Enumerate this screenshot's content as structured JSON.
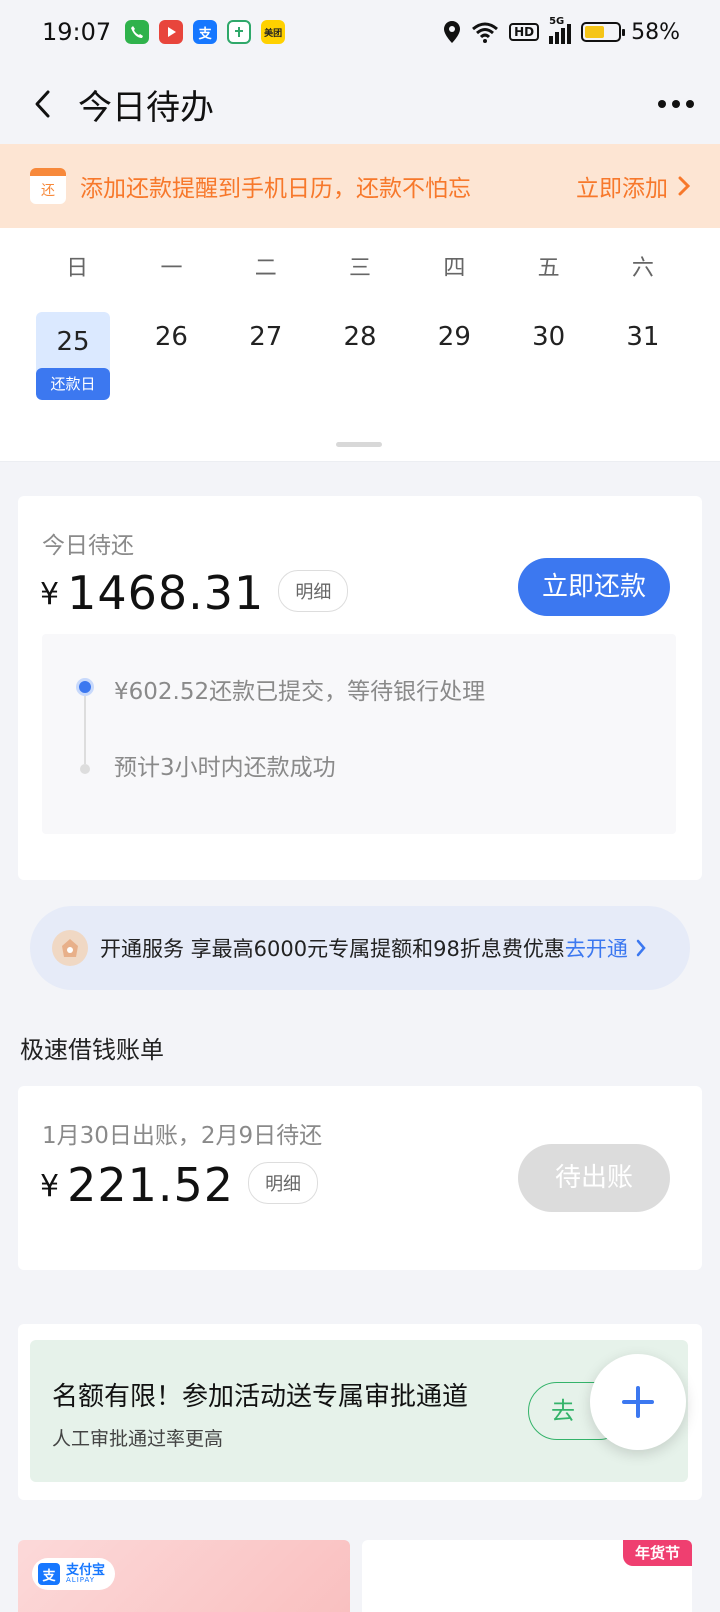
{
  "status_bar": {
    "time": "19:07",
    "battery": "58%",
    "battery_level": 0.58,
    "hd": "HD",
    "network": "5G",
    "app_icons": [
      "phone-icon",
      "video-icon",
      "alipay-icon",
      "health-icon",
      "meituan-icon"
    ],
    "meituan_label": "美团"
  },
  "nav": {
    "title": "今日待办"
  },
  "reminder": {
    "icon_label": "还",
    "text": "添加还款提醒到手机日历，还款不怕忘",
    "action": "立即添加"
  },
  "calendar": {
    "weekdays": [
      "日",
      "一",
      "二",
      "三",
      "四",
      "五",
      "六"
    ],
    "dates": [
      "25",
      "26",
      "27",
      "28",
      "29",
      "30",
      "31"
    ],
    "selected_date": "25",
    "selected_tag": "还款日"
  },
  "today": {
    "label": "今日待还",
    "currency": "¥",
    "amount": "1468.31",
    "detail": "明细",
    "pay_button": "立即还款",
    "steps": [
      "¥602.52还款已提交，等待银行处理",
      "预计3小时内还款成功"
    ]
  },
  "promo": {
    "text": "开通服务 享最高6000元专属提额和98折息费优惠",
    "action": "去开通"
  },
  "bill_section": {
    "title": "极速借钱账单",
    "info": "1月30日出账，2月9日待还",
    "currency": "¥",
    "amount": "221.52",
    "detail": "明细",
    "status_button": "待出账"
  },
  "activity": {
    "title": "名额有限！参加活动送专属审批通道",
    "subtitle": "人工审批通过率更高",
    "button": "去"
  },
  "bottom": {
    "alipay_cn": "支付宝",
    "alipay_en": "ALIPAY",
    "alipay_logo": "支",
    "new_year_tag": "年货节"
  },
  "colors": {
    "accent": "#3c78f0",
    "reminder_bg": "#fde5d3",
    "reminder_text": "#f7782b",
    "activity_green": "#34b36a"
  }
}
